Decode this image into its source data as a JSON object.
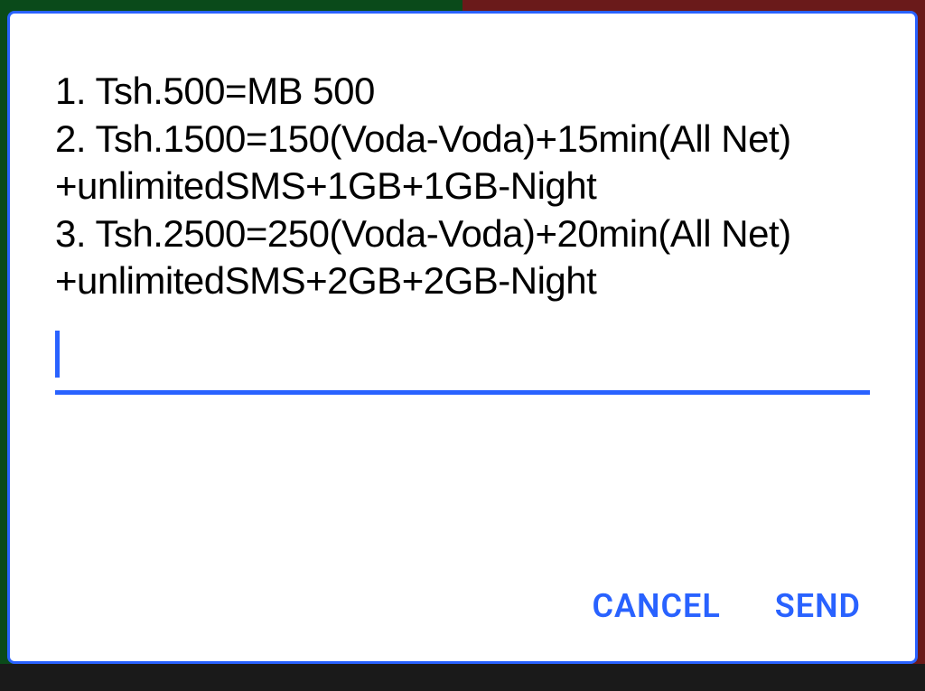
{
  "dialog": {
    "message_text": "1. Tsh.500=MB 500\n2. Tsh.1500=150(Voda-Voda)+15min(All Net)\n+unlimitedSMS+1GB+1GB-Night\n3. Tsh.2500=250(Voda-Voda)+20min(All Net)\n+unlimitedSMS+2GB+2GB-Night",
    "input_value": "",
    "buttons": {
      "cancel": "CANCEL",
      "send": "SEND"
    }
  },
  "colors": {
    "accent": "#2962ff"
  }
}
